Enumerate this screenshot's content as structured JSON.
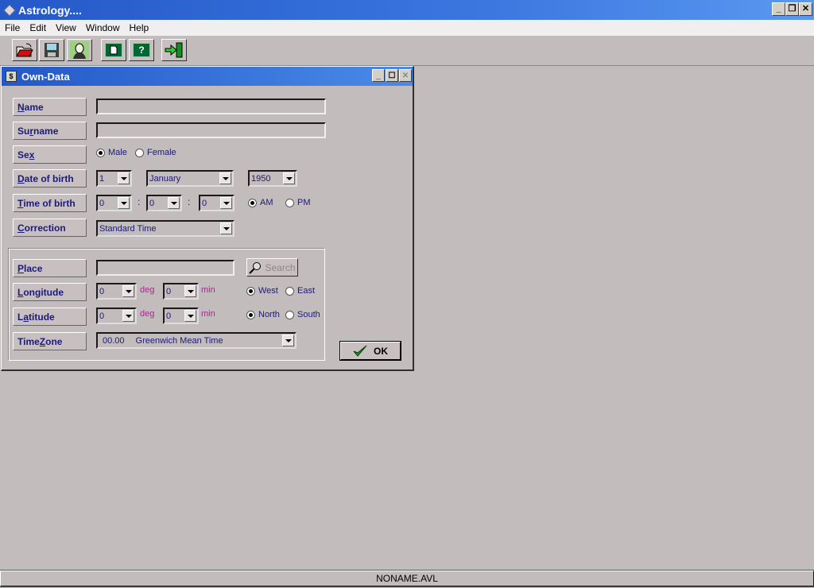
{
  "app": {
    "title": "Astrology....",
    "window_controls": {
      "minimize": "_",
      "restore": "❐",
      "close": "✕"
    }
  },
  "menu": [
    "File",
    "Edit",
    "View",
    "Window",
    "Help"
  ],
  "toolbar": {
    "buttons": [
      {
        "name": "open-folder-icon",
        "tooltip": "Open"
      },
      {
        "name": "save-disk-icon",
        "tooltip": "Save"
      },
      {
        "name": "portrait-icon",
        "tooltip": "Own-Data"
      },
      {
        "name": "document-icon",
        "tooltip": "Document"
      },
      {
        "name": "help-icon",
        "tooltip": "Help",
        "glyph": "?"
      },
      {
        "name": "exit-door-icon",
        "tooltip": "Exit"
      }
    ]
  },
  "dialog": {
    "title": "Own-Data",
    "labels": {
      "name": {
        "pre": "",
        "u": "N",
        "post": "ame"
      },
      "surname": {
        "pre": "Su",
        "u": "r",
        "post": "name"
      },
      "sex": {
        "pre": "Se",
        "u": "x",
        "post": ""
      },
      "dob": {
        "pre": "",
        "u": "D",
        "post": "ate of birth"
      },
      "tob": {
        "pre": "",
        "u": "T",
        "post": "ime of birth"
      },
      "correction": {
        "pre": "",
        "u": "C",
        "post": "orrection"
      },
      "place": {
        "pre": "",
        "u": "P",
        "post": "lace"
      },
      "longitude": {
        "pre": "",
        "u": "L",
        "post": "ongitude"
      },
      "latitude": {
        "pre": "L",
        "u": "a",
        "post": "titude"
      },
      "timezone": {
        "pre": "Time ",
        "u": "Z",
        "post": "one"
      }
    },
    "name_value": "",
    "surname_value": "",
    "sex": {
      "options": [
        "Male",
        "Female"
      ],
      "selected": "Male"
    },
    "dob": {
      "day": "1",
      "month": "January",
      "year": "1950"
    },
    "tob": {
      "hour": "0",
      "minute": "0",
      "second": "0",
      "separator": ":",
      "ampm_options": [
        "AM",
        "PM"
      ],
      "ampm_selected": "AM"
    },
    "correction": "Standard Time",
    "place_value": "",
    "search_label": "Search",
    "longitude": {
      "deg": "0",
      "min": "0",
      "deg_unit": "deg",
      "min_unit": "min",
      "dir_options": [
        "West",
        "East"
      ],
      "dir_selected": "West"
    },
    "latitude": {
      "deg": "0",
      "min": "0",
      "deg_unit": "deg",
      "min_unit": "min",
      "dir_options": [
        "North",
        "South"
      ],
      "dir_selected": "North"
    },
    "timezone": {
      "offset": "00.00",
      "name": "Greenwich Mean Time"
    },
    "ok_label": "OK"
  },
  "status": {
    "filename": "NONAME.AVL"
  }
}
